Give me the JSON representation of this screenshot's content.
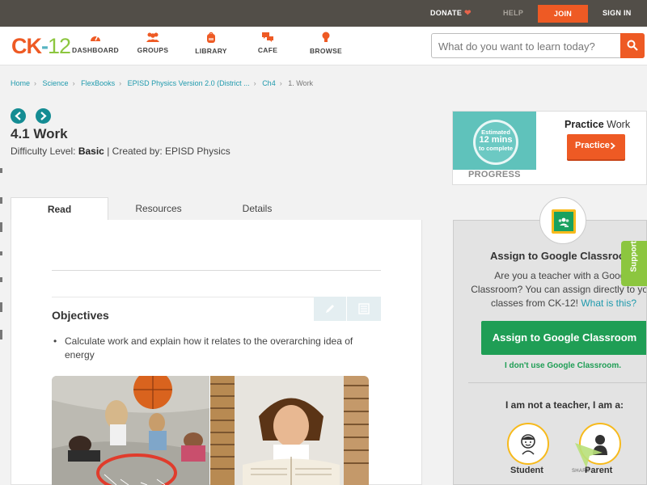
{
  "topbar": {
    "donate": "DONATE",
    "help": "HELP",
    "join": "JOIN",
    "signin": "SIGN IN"
  },
  "header": {
    "logo": {
      "ck": "CK",
      "dash": "-",
      "num": "12"
    },
    "nav": [
      {
        "label": "DASHBOARD",
        "icon": "gauge-icon"
      },
      {
        "label": "GROUPS",
        "icon": "people-icon"
      },
      {
        "label": "LIBRARY",
        "icon": "backpack-icon"
      },
      {
        "label": "CAFE",
        "icon": "chat-bubbles-icon"
      },
      {
        "label": "BROWSE",
        "icon": "lightbulb-icon"
      }
    ],
    "search": {
      "placeholder": "What do you want to learn today?"
    }
  },
  "breadcrumb": [
    "Home",
    "Science",
    "FlexBooks",
    "EPISD Physics Version 2.0 (District ...",
    "Ch4",
    "1. Work"
  ],
  "lesson": {
    "title": "4.1 Work",
    "difficulty_label": "Difficulty Level:",
    "difficulty_value": "Basic",
    "separator": "|",
    "created_by": "Created by: EPISD Physics"
  },
  "tabs": [
    "Read",
    "Resources",
    "Details"
  ],
  "content": {
    "objectives_title": "Objectives",
    "objectives": [
      "Calculate work and explain how it relates to the overarching idea of energy"
    ]
  },
  "practice": {
    "estimated_line1": "Estimated",
    "estimated_line2": "12 mins",
    "estimated_line3": "to complete",
    "progress_label": "PROGRESS",
    "title_bold": "Practice",
    "title_rest": "Work",
    "button": "Practice"
  },
  "google_classroom": {
    "title": "Assign to Google Classroom",
    "text_line1": "Are you a teacher with a Google",
    "text_line2": "Classroom? You can assign directly to your",
    "text_line3": "classes from CK-12!",
    "what_is_this": "What is this?",
    "button": "Assign to Google Classroom",
    "dont_use": "I don't use Google Classroom.",
    "not_teacher": "I am not a teacher, I am a:",
    "roles": [
      "Student",
      "Parent"
    ],
    "share": "SHARE"
  },
  "support": "Support",
  "colors": {
    "brand_orange": "#ee5a24",
    "teal": "#1f9aad",
    "green": "#1f9e55",
    "support_green": "#8cc63f",
    "topbar": "#524e48"
  }
}
